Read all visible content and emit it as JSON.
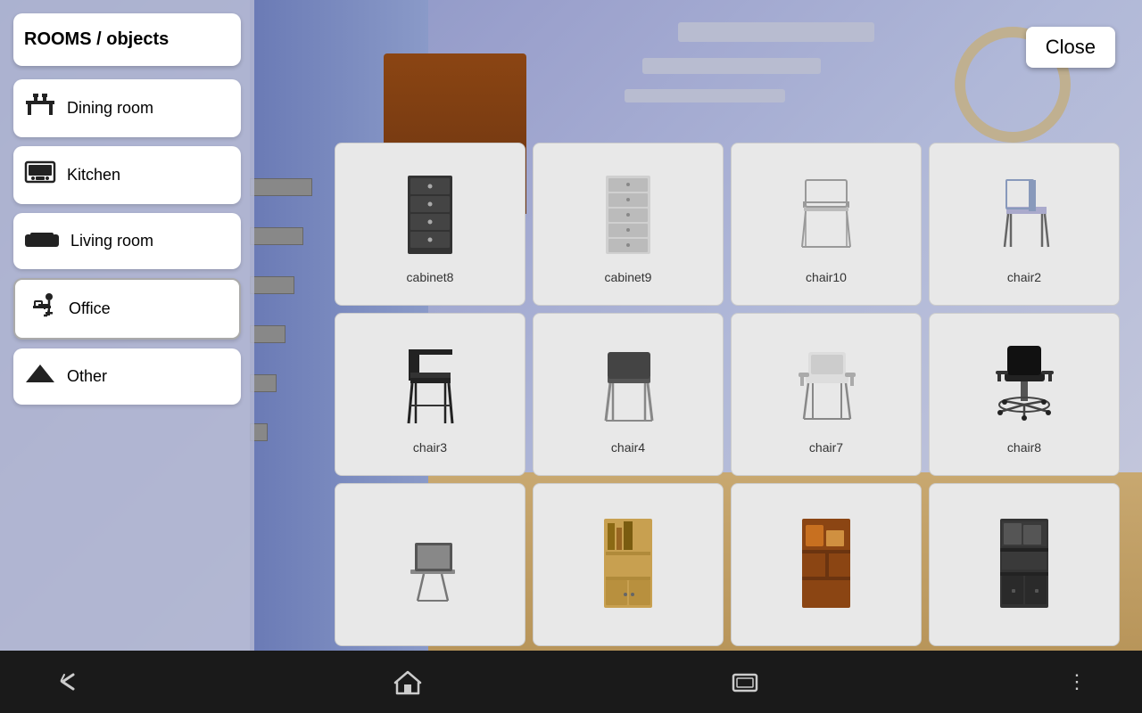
{
  "app": {
    "title": "ROOMS / objects",
    "close_label": "Close"
  },
  "sidebar": {
    "items": [
      {
        "id": "dining",
        "label": "Dining room",
        "icon": "dining"
      },
      {
        "id": "kitchen",
        "label": "Kitchen",
        "icon": "kitchen"
      },
      {
        "id": "living",
        "label": "Living room",
        "icon": "living"
      },
      {
        "id": "office",
        "label": "Office",
        "icon": "office",
        "active": true
      },
      {
        "id": "other",
        "label": "Other",
        "icon": "other"
      }
    ]
  },
  "objects": [
    {
      "id": "cabinet8",
      "label": "cabinet8"
    },
    {
      "id": "cabinet9",
      "label": "cabinet9"
    },
    {
      "id": "chair10",
      "label": "chair10"
    },
    {
      "id": "chair2",
      "label": "chair2"
    },
    {
      "id": "chair3",
      "label": "chair3"
    },
    {
      "id": "chair4",
      "label": "chair4"
    },
    {
      "id": "chair7",
      "label": "chair7"
    },
    {
      "id": "chair8",
      "label": "chair8"
    },
    {
      "id": "desk1",
      "label": ""
    },
    {
      "id": "shelf1",
      "label": ""
    },
    {
      "id": "shelf2",
      "label": ""
    },
    {
      "id": "shelf3",
      "label": ""
    }
  ],
  "nav": {
    "back_label": "←",
    "home_label": "⌂",
    "recents_label": "▭",
    "more_label": "⋮"
  },
  "colors": {
    "bg": "#8899cc",
    "sidebar_bg": "#b4b9d2",
    "panel_bg": "#e8e8e8",
    "nav_bg": "#1a1a1a",
    "white": "#ffffff",
    "accent": "#555555"
  }
}
